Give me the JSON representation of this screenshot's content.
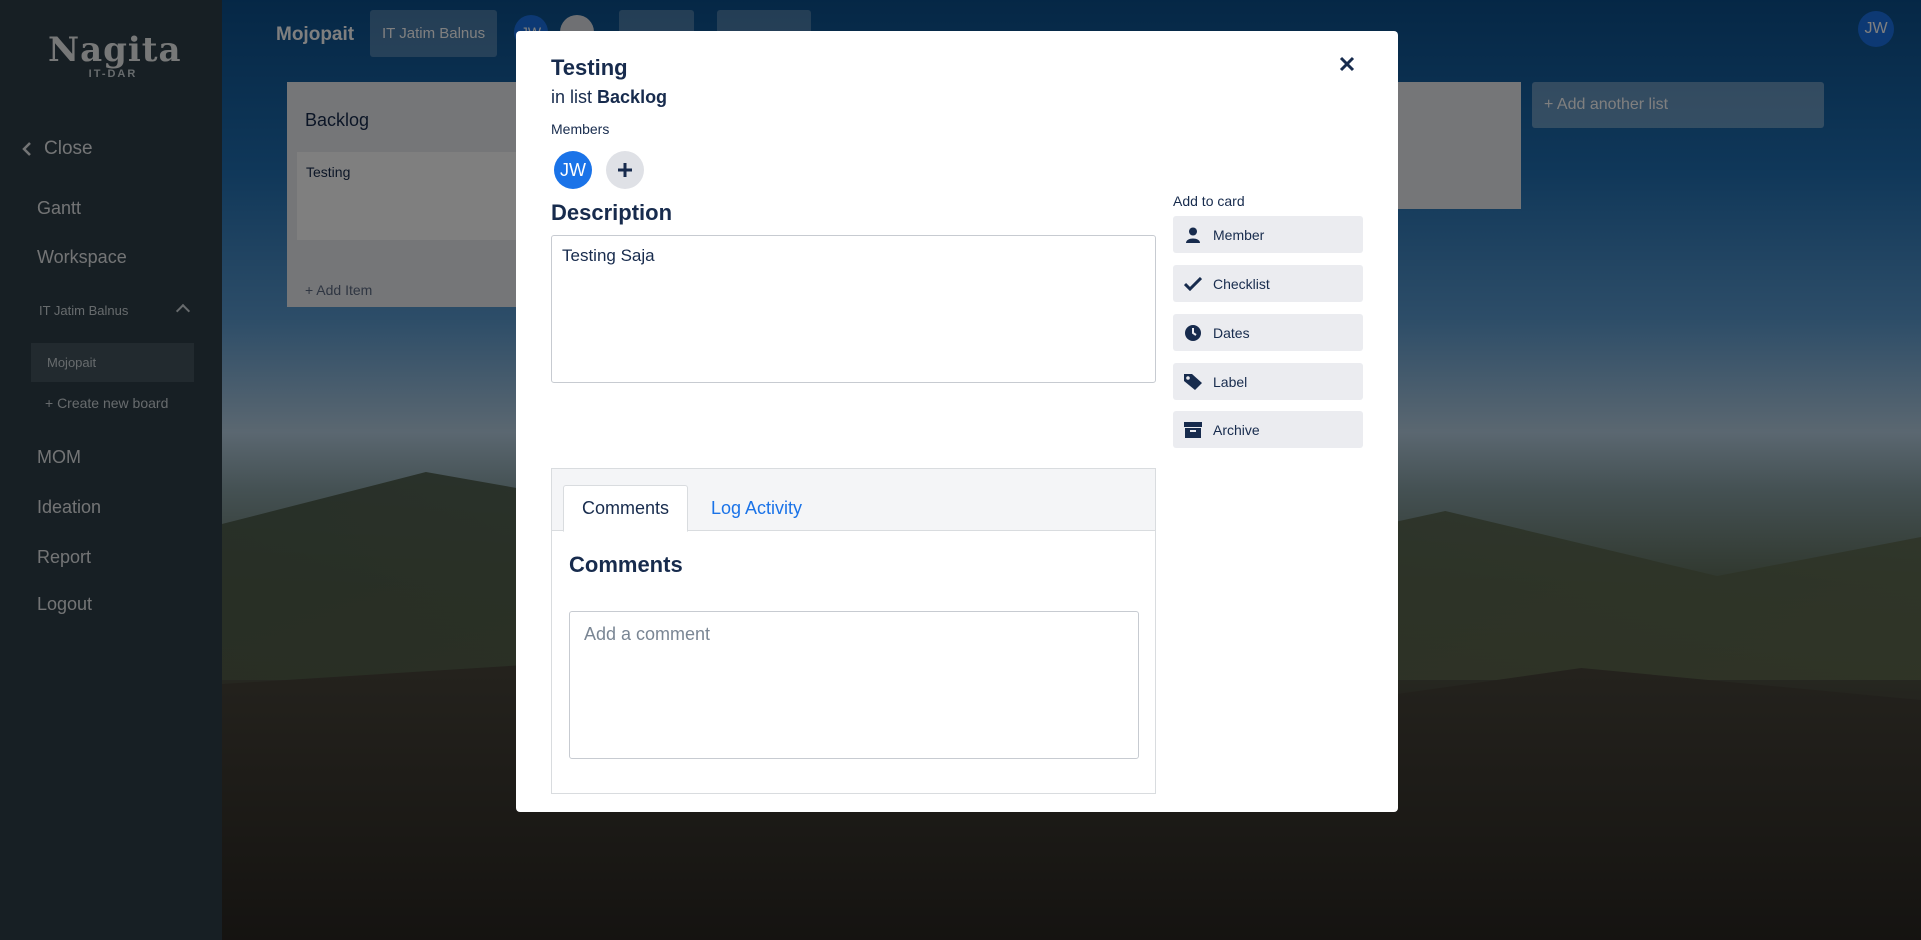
{
  "sidebar": {
    "logo_name": "Nagita",
    "logo_sub": "IT-DAR",
    "close_label": "Close",
    "items": [
      "Gantt",
      "Workspace",
      "MOM",
      "Ideation",
      "Report",
      "Logout"
    ],
    "workspace_group": "IT Jatim Balnus",
    "active_board": "Mojopait",
    "create_board": "+ Create new board"
  },
  "topbar": {
    "board_title": "Mojopait",
    "workspace_button": "IT Jatim Balnus",
    "avatar_initials": "JW",
    "user_avatar": "JW"
  },
  "board": {
    "list_title": "Backlog",
    "card_title": "Testing",
    "add_item": "+ Add Item",
    "add_list": "+ Add another list"
  },
  "modal": {
    "title": "Testing",
    "in_list_prefix": "in list",
    "in_list_name": "Backlog",
    "members_label": "Members",
    "member_initials": "JW",
    "description_title": "Description",
    "description_text": "Testing Saja",
    "add_to_card_label": "Add to card",
    "actions": [
      {
        "label": "Member",
        "icon": "user-icon"
      },
      {
        "label": "Checklist",
        "icon": "check-icon"
      },
      {
        "label": "Dates",
        "icon": "clock-icon"
      },
      {
        "label": "Label",
        "icon": "tag-icon"
      },
      {
        "label": "Archive",
        "icon": "archive-icon"
      }
    ],
    "tabs": [
      "Comments",
      "Log Activity"
    ],
    "comments_heading": "Comments",
    "comment_placeholder": "Add a comment"
  },
  "colors": {
    "accent": "#1a73e8",
    "sidebar": "#2e3e49",
    "text": "#172b4d"
  }
}
